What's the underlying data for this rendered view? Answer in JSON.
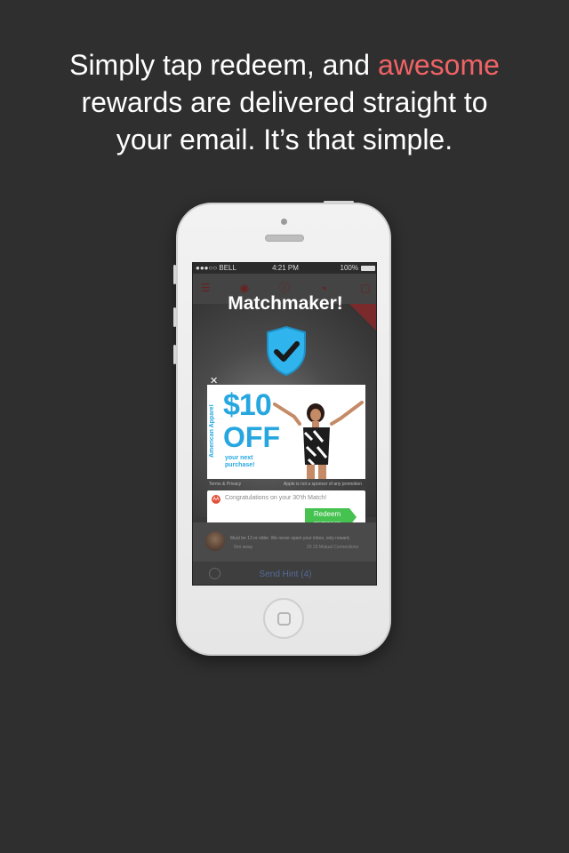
{
  "headline": {
    "part1": "Simply tap redeem, and ",
    "accent": "awesome",
    "part2": "rewards are delivered straight to",
    "part3": "your email. It’s that simple."
  },
  "status_bar": {
    "carrier": "●●●○○ BELL",
    "time": "4:21 PM",
    "battery": "100%"
  },
  "modal": {
    "title": "Matchmaker!"
  },
  "ad": {
    "brand": "American Apparel",
    "amount": "$10",
    "off": "OFF",
    "subtitle": "your next purchase!",
    "terms": "Terms & Privacy",
    "disclaimer": "Apple is not a sponsor of any promotion"
  },
  "reward": {
    "logo": "AA",
    "message": "Congratulations on your 30'th Match!",
    "redeem_label": "Redeem",
    "redeem_sub": "and return to app"
  },
  "profile": {
    "line1": "Must be 13 or older. We never spam your inbox, only reward.",
    "line2": "5mi away",
    "line3": "20   23 Mutual Connections"
  },
  "hint": {
    "label": "Send Hint (4)"
  },
  "colors": {
    "accent": "#f06366",
    "shield": "#2fb4ee",
    "redeem": "#45c24f",
    "ad_blue": "#26a7e0"
  }
}
